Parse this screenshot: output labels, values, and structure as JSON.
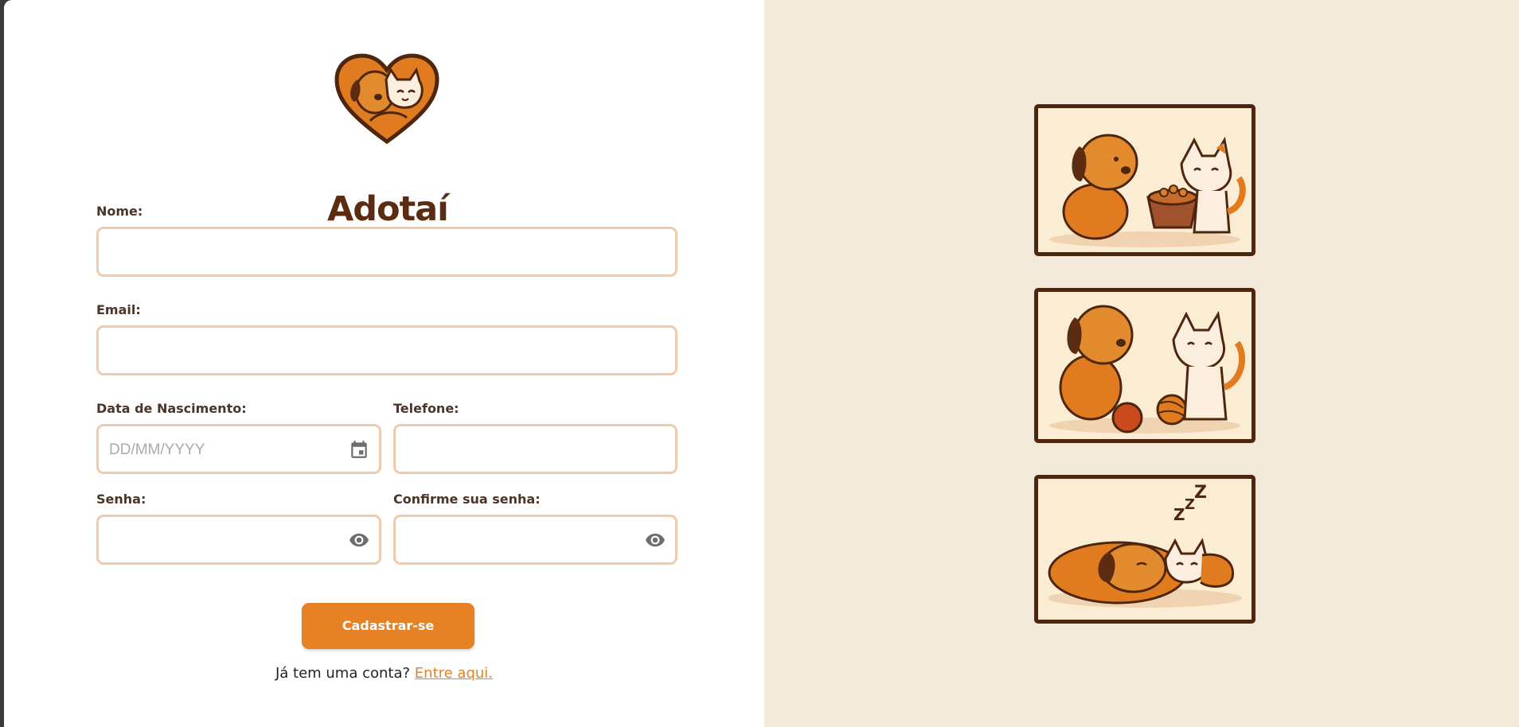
{
  "brand": {
    "name": "Adotaí"
  },
  "form": {
    "name_label": "Nome:",
    "email_label": "Email:",
    "birth_label": "Data de Nascimento:",
    "birth_placeholder": "DD/MM/YYYY",
    "phone_label": "Telefone:",
    "password_label": "Senha:",
    "confirm_label": "Confirme sua senha:",
    "submit_label": "Cadastrar-se",
    "login_prompt": "Já tem uma conta?",
    "login_link": "Entre aqui."
  },
  "colors": {
    "accent": "#e78126",
    "brown": "#5b2c12",
    "field_border": "#f0cba9",
    "panel_bg": "#f3e9da"
  },
  "illustrations": [
    {
      "icon": "dog-and-cat-eating-illustration"
    },
    {
      "icon": "dog-and-cat-playing-illustration"
    },
    {
      "icon": "dog-and-cat-sleeping-illustration"
    }
  ]
}
